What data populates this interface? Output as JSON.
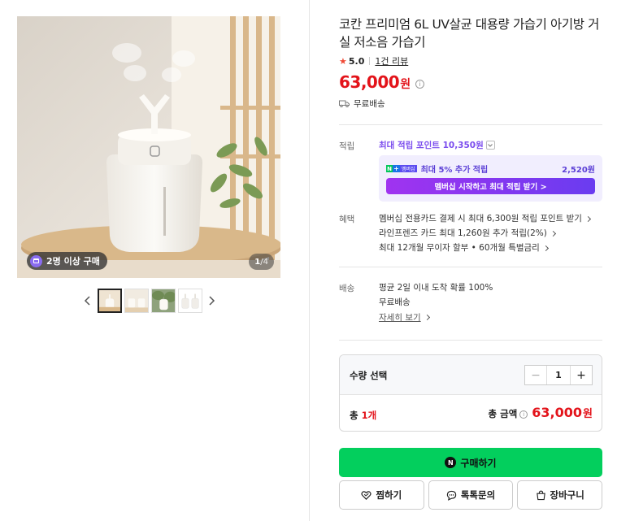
{
  "gallery": {
    "buyer_badge": "2명 이상 구매",
    "page_current": "1",
    "page_total": "/4",
    "thumbnails": [
      "thumb-1",
      "thumb-2",
      "thumb-3",
      "thumb-4"
    ],
    "active_thumb": 1
  },
  "product": {
    "title": "코칸 프리미엄 6L UV살균 대용량 가습기 아기방 거실 저소음 가습기",
    "rating": "5.0",
    "reviews": "1건 리뷰",
    "price": "63,000",
    "price_unit": "원",
    "shipping": "무료배송"
  },
  "points": {
    "label": "적립",
    "max_points": "최대 적립 포인트 10,350원",
    "member_line": "최대 5% 추가 적립",
    "member_amount": "2,520원",
    "member_button": "멤버십 시작하고 최대 적립 받기 >",
    "npay_badge": "N",
    "plus_badge": "+",
    "membership_badge": "멤버십"
  },
  "benefits": {
    "label": "혜택",
    "items": [
      "멤버십 전용카드 결제 시 최대 6,300원 적립 포인트 받기",
      "라인프렌즈 카드 최대 1,260원 추가 적립(2%)",
      "최대 12개월 무이자 할부 • 60개월 특별금리"
    ]
  },
  "delivery": {
    "label": "배송",
    "line1": "평균 2일 이내 도착 확률 100%",
    "line2": "무료배송",
    "detail_link": "자세히 보기"
  },
  "quantity": {
    "label": "수량 선택",
    "minus": "−",
    "value": "1",
    "plus": "+",
    "total_prefix": "총 ",
    "total_count": "1개",
    "sum_label": "총 금액",
    "sum_amount": "63,000",
    "sum_unit": "원"
  },
  "actions": {
    "buy": "구매하기",
    "buy_icon": "N",
    "wishlist": "찜하기",
    "talk": "톡톡문의",
    "cart": "장바구니"
  },
  "colors": {
    "price_red": "#e3131a",
    "buy_green": "#03cf5d",
    "point_purple": "#7b4dee"
  }
}
